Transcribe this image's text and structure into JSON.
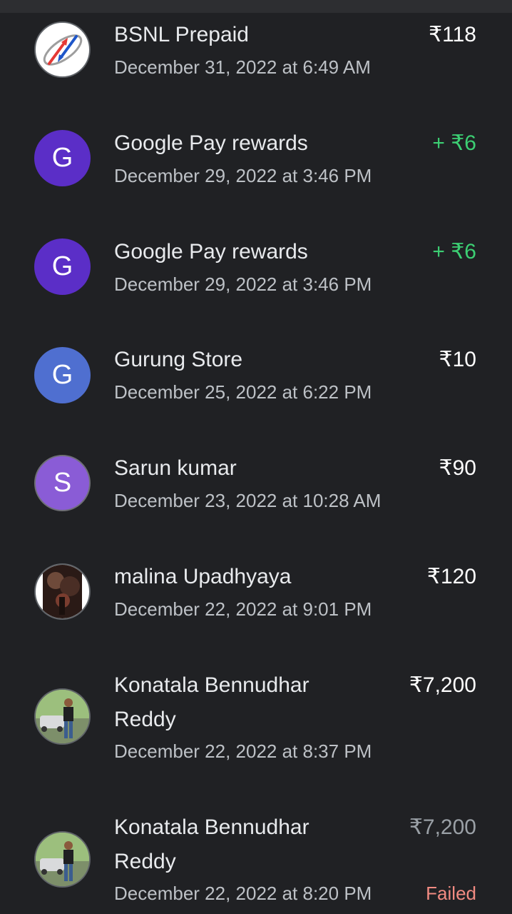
{
  "transactions": [
    {
      "name": "BSNL Prepaid",
      "date": "December 31, 2022 at 6:49 AM",
      "amount": "₹118",
      "avatar": "bsnl-logo"
    },
    {
      "name": "Google Pay rewards",
      "date": "December 29, 2022 at 3:46 PM",
      "amount": "+ ₹6",
      "avatar_letter": "G"
    },
    {
      "name": "Google Pay rewards",
      "date": "December 29, 2022 at 3:46 PM",
      "amount": "+ ₹6",
      "avatar_letter": "G"
    },
    {
      "name": "Gurung Store",
      "date": "December 25, 2022 at 6:22 PM",
      "amount": "₹10",
      "avatar_letter": "G"
    },
    {
      "name": "Sarun kumar",
      "date": "December 23, 2022 at 10:28 AM",
      "amount": "₹90",
      "avatar_letter": "S"
    },
    {
      "name": "malina Upadhyaya",
      "date": "December 22, 2022 at 9:01 PM",
      "amount": "₹120",
      "avatar": "profile-photo"
    },
    {
      "name_line1": "Konatala Bennudhar",
      "name_line2": "Reddy",
      "date": "December 22, 2022 at 8:37 PM",
      "amount": "₹7,200",
      "avatar": "profile-photo"
    },
    {
      "name_line1": "Konatala Bennudhar",
      "name_line2": "Reddy",
      "date": "December 22, 2022 at 8:20 PM",
      "amount": "₹7,200",
      "status": "Failed",
      "avatar": "profile-photo"
    }
  ],
  "colors": {
    "background": "#202124",
    "credit_green": "#3ccf73",
    "failed_red": "#f28b82",
    "google_pay_purple": "#5b2ec7",
    "store_blue": "#4f6fd0",
    "person_purple": "#8a5cd6"
  }
}
